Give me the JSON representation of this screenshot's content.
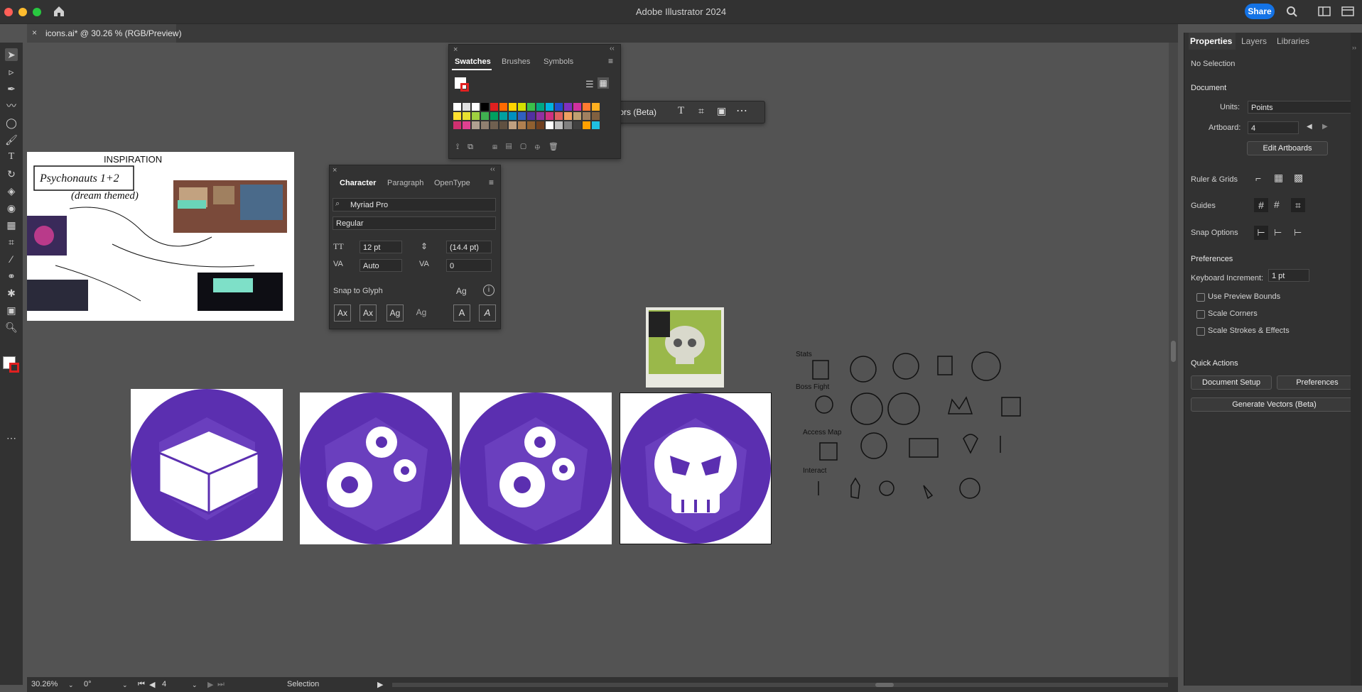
{
  "app_title": "Adobe Illustrator 2024",
  "share_label": "Share",
  "document_tab": "icons.ai* @ 30.26 % (RGB/Preview)",
  "swatches_panel": {
    "tabs": [
      "Swatches",
      "Brushes",
      "Symbols"
    ]
  },
  "context_bar": {
    "label": "tors (Beta)"
  },
  "character_panel": {
    "tabs": [
      "Character",
      "Paragraph",
      "OpenType"
    ],
    "font_family": "Myriad Pro",
    "font_style": "Regular",
    "font_size": "12 pt",
    "leading": "(14.4 pt)",
    "kerning": "Auto",
    "tracking": "0",
    "snap_to_glyph": "Snap to Glyph"
  },
  "properties_panel": {
    "tabs": [
      "Properties",
      "Layers",
      "Libraries"
    ],
    "selection": "No Selection",
    "document_heading": "Document",
    "units_label": "Units:",
    "units_value": "Points",
    "artboard_label": "Artboard:",
    "artboard_value": "4",
    "edit_artboards": "Edit Artboards",
    "ruler_grids": "Ruler & Grids",
    "guides": "Guides",
    "snap_options": "Snap Options",
    "preferences_heading": "Preferences",
    "keyboard_increment_label": "Keyboard Increment:",
    "keyboard_increment_value": "1 pt",
    "use_preview_bounds": "Use Preview Bounds",
    "scale_corners": "Scale Corners",
    "scale_strokes": "Scale Strokes & Effects",
    "quick_actions": "Quick Actions",
    "document_setup": "Document Setup",
    "preferences_button": "Preferences",
    "generate_vectors": "Generate Vectors (Beta)"
  },
  "moodboard": {
    "title": "INSPIRATION",
    "subtitle": "Psychonauts 1+2",
    "subtitle2": "(dream themed)"
  },
  "sketches": {
    "row1": "Stats",
    "row2": "Boss Fight",
    "row3": "Access Map",
    "row4": "Interact"
  },
  "status_bar": {
    "zoom": "30.26%",
    "rotation": "0°",
    "artboard": "4",
    "tool": "Selection"
  },
  "colors": {
    "accent": "#1473e6",
    "icon_purple": "#5b2fb0",
    "icon_purple_light": "#7a52c8"
  }
}
